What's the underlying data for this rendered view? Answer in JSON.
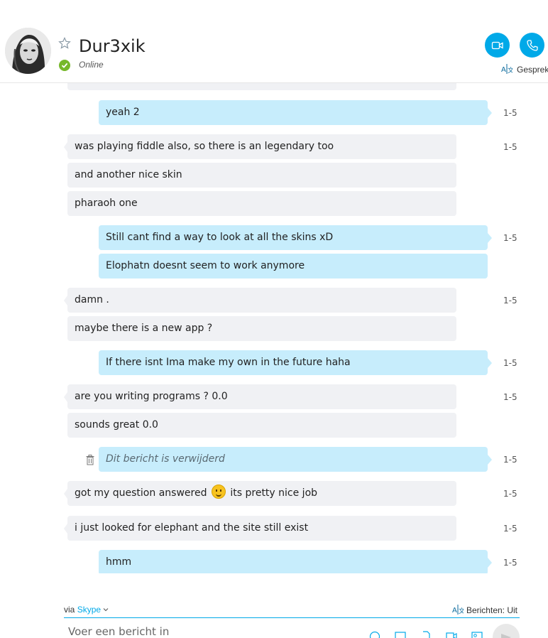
{
  "contact": {
    "name": "Dur3xik",
    "status": "Online"
  },
  "header": {
    "translate_label": "Gesprek"
  },
  "messages": [
    {
      "dir": "in",
      "text": "",
      "time": ""
    },
    {
      "dir": "out",
      "text": "yeah 2",
      "time": "1-5"
    },
    {
      "dir": "in",
      "text": "was playing fiddle also, so there is an legendary too",
      "time": "1-5"
    },
    {
      "dir": "in",
      "text": "and another nice skin",
      "time": ""
    },
    {
      "dir": "in",
      "text": "pharaoh one",
      "time": ""
    },
    {
      "dir": "out",
      "text": "Still cant find a way to look at all the skins xD",
      "time": "1-5"
    },
    {
      "dir": "out",
      "text": "Elophatn doesnt seem to work anymore",
      "time": ""
    },
    {
      "dir": "in",
      "text": "damn .",
      "time": "1-5"
    },
    {
      "dir": "in",
      "text": "maybe there is a new app ?",
      "time": ""
    },
    {
      "dir": "out",
      "text": "If there isnt Ima make my own in the future haha",
      "time": "1-5"
    },
    {
      "dir": "in",
      "text": "are you writing programs ? 0.0",
      "time": "1-5"
    },
    {
      "dir": "in",
      "text": "sounds great 0.0",
      "time": ""
    },
    {
      "dir": "out",
      "text": "Dit bericht is verwijderd",
      "time": "1-5",
      "deleted": true
    },
    {
      "dir": "in",
      "text_before": "got my question answered",
      "text_after": "its pretty nice job",
      "time": "1-5",
      "emoji": "smile-emoji"
    },
    {
      "dir": "in",
      "text": "i just looked for elephant and the site still exist",
      "time": "1-5"
    },
    {
      "dir": "out",
      "text": "hmm",
      "time": "1-5"
    }
  ],
  "footer": {
    "via_prefix": "via",
    "via_service": "Skype",
    "translate_label": "Berichten: Uit",
    "compose_placeholder": "Voer een bericht in"
  },
  "colors": {
    "accent": "#00a9e8",
    "incoming_bubble": "#f0f1f4",
    "outgoing_bubble": "#c7edfc",
    "presence_online": "#76b82a"
  },
  "icons": [
    "star-icon",
    "video-call-icon",
    "phone-icon",
    "translate-icon",
    "trash-icon",
    "chevron-down-icon",
    "emoji-icon",
    "image-icon",
    "file-icon",
    "video-message-icon",
    "contact-card-icon",
    "send-icon"
  ]
}
